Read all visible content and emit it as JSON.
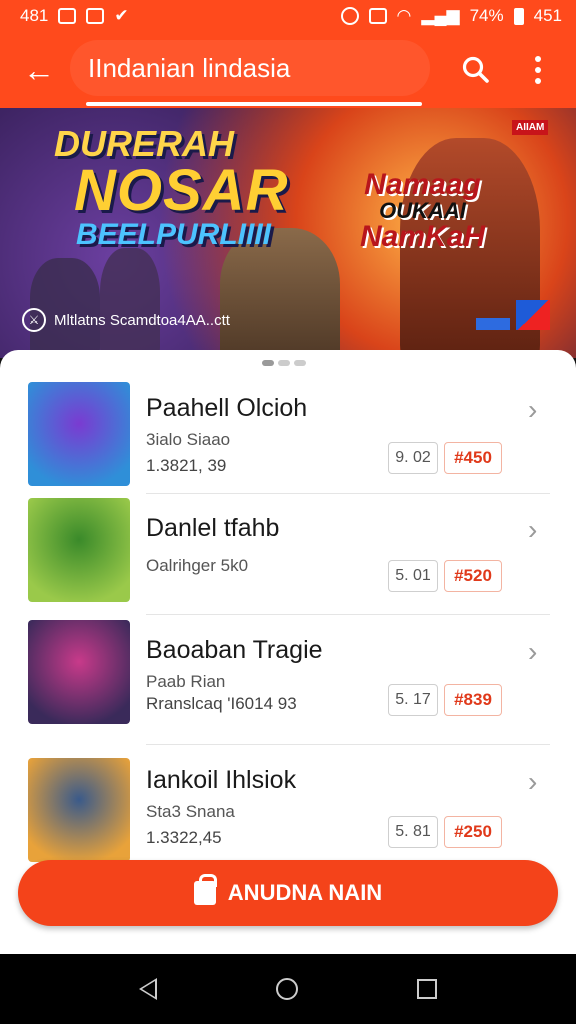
{
  "status_bar": {
    "time": "481",
    "battery_percent": "74%",
    "right_time": "451"
  },
  "header": {
    "back_icon": "arrow-left-icon",
    "title": "IIndanian lindasia",
    "search_icon": "search-icon",
    "menu_icon": "more-vert-icon"
  },
  "banner": {
    "title_line1": "DURERAH",
    "title_line2": "NOSAR",
    "title_line3": "BEELPURLIIII",
    "side_line1": "Namaag",
    "side_line2": "OUKAAI",
    "side_line3": "NamKaH",
    "caption": "Mltlatns Scamdtoa4AA..ctt",
    "badge_top": "AIIAM"
  },
  "items": [
    {
      "title": "Paahell Olcioh",
      "subtitle": "3ialo Siaao",
      "detail": "1.3821, 39",
      "qty": "9. 02",
      "price": "#450",
      "thumb_colors": [
        "#7a3bd1",
        "#2f8fd8"
      ]
    },
    {
      "title": "Danlel tfahb",
      "subtitle": "Oalrihger 5k0",
      "detail": "",
      "qty": "5. 01",
      "price": "#520",
      "thumb_colors": [
        "#3a8a2a",
        "#9ac94a"
      ]
    },
    {
      "title": "Baoaban Tragie",
      "subtitle": "Paab Rian",
      "detail": "Rranslcaq 'I6014 93",
      "qty": "5. 17",
      "price": "#839",
      "thumb_colors": [
        "#c83a8a",
        "#3a2a5a"
      ]
    },
    {
      "title": "Iankoil Ihlsiok",
      "subtitle": "Sta3 Snana",
      "detail": "1.3322,45",
      "qty": "5. 81",
      "price": "#250",
      "thumb_colors": [
        "#3a5a8a",
        "#e8a23a"
      ]
    }
  ],
  "cta": {
    "label": "ANUDNA NAIN",
    "icon": "shopping-bag-icon"
  },
  "nav": {
    "back_icon": "nav-back-icon",
    "home_icon": "nav-home-icon",
    "recents_icon": "nav-recents-icon"
  },
  "colors": {
    "accent": "#ff4a1c",
    "price_text": "#e0391a",
    "cta": "#f4431a"
  }
}
